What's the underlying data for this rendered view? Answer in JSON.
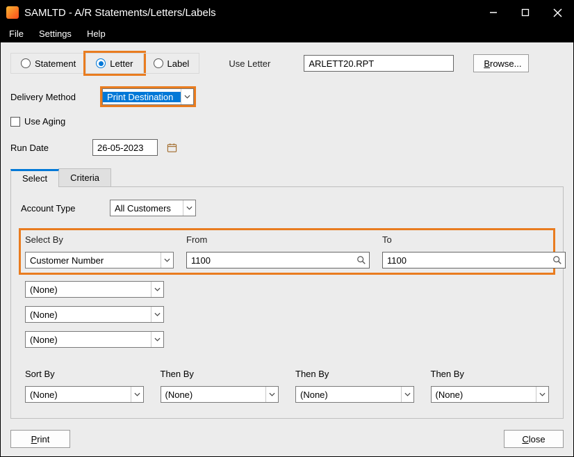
{
  "window": {
    "title": "SAMLTD - A/R Statements/Letters/Labels"
  },
  "menubar": {
    "file": "File",
    "settings": "Settings",
    "help": "Help"
  },
  "radios": {
    "statement": "Statement",
    "letter": "Letter",
    "label": "Label"
  },
  "top": {
    "use_letter_label": "Use Letter",
    "use_letter_value": "ARLETT20.RPT",
    "browse_label": "Browse..."
  },
  "delivery": {
    "label": "Delivery Method",
    "value": "Print Destination"
  },
  "aging": {
    "label": "Use Aging"
  },
  "rundate": {
    "label": "Run Date",
    "value": "26-05-2023"
  },
  "tabs": {
    "select": "Select",
    "criteria": "Criteria"
  },
  "account_type": {
    "label": "Account Type",
    "value": "All Customers"
  },
  "selectby": {
    "header_selectby": "Select By",
    "header_from": "From",
    "header_to": "To",
    "row1": {
      "by": "Customer Number",
      "from": "1100",
      "to": "1100"
    },
    "none": "(None)"
  },
  "sortby": {
    "col1": "Sort By",
    "col2": "Then By",
    "col3": "Then By",
    "col4": "Then By",
    "none": "(None)"
  },
  "footer": {
    "print": "Print",
    "close": "Close"
  }
}
